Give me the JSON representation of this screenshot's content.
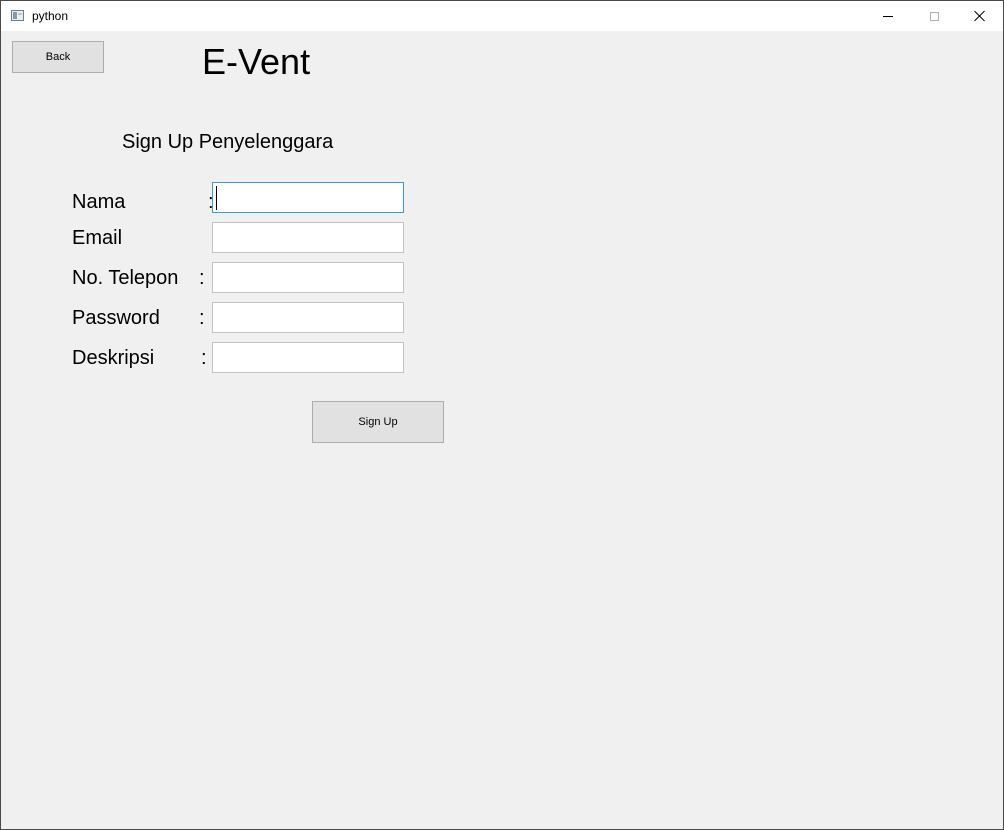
{
  "window": {
    "title": "python",
    "icon": "python-app-icon",
    "controls": [
      "minimize-icon",
      "maximize-icon",
      "close-icon"
    ]
  },
  "toolbar": {
    "back_label": "Back"
  },
  "header": {
    "app_title": "E-Vent",
    "subtitle": "Sign Up Penyelenggara"
  },
  "form": {
    "fields": [
      {
        "label": "Nama",
        "colon": ":",
        "value": "",
        "focused": true
      },
      {
        "label": "Email",
        "colon": "",
        "value": "",
        "focused": false
      },
      {
        "label": "No. Telepon",
        "colon": ":",
        "value": "",
        "focused": false
      },
      {
        "label": "Password",
        "colon": ":",
        "value": "",
        "focused": false
      },
      {
        "label": "Deskripsi",
        "colon": ":",
        "value": "",
        "focused": false
      }
    ],
    "submit_label": "Sign Up"
  },
  "colors": {
    "window_bg": "#f0f0f0",
    "titlebar_bg": "#ffffff",
    "button_bg": "#e1e1e1",
    "button_border": "#adadad",
    "focus_border": "#3c9ad6"
  }
}
